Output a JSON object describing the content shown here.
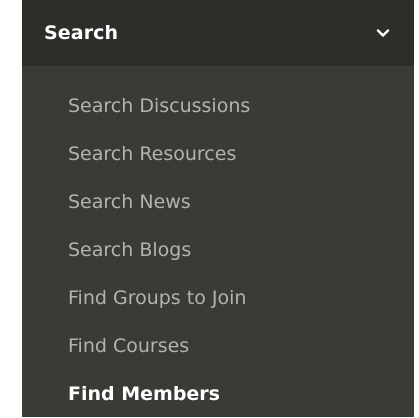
{
  "menu": {
    "title": "Search",
    "toggle_icon": "chevron-down-icon",
    "items": [
      {
        "label": "Search Discussions",
        "active": false
      },
      {
        "label": "Search Resources",
        "active": false
      },
      {
        "label": "Search News",
        "active": false
      },
      {
        "label": "Search Blogs",
        "active": false
      },
      {
        "label": "Find Groups to Join",
        "active": false
      },
      {
        "label": "Find Courses",
        "active": false
      },
      {
        "label": "Find Members",
        "active": true
      }
    ]
  },
  "colors": {
    "menu_background": "#3c3a37",
    "header_background": "#2f2d2a",
    "item_text": "#b4b2ae",
    "active_text": "#ffffff"
  }
}
